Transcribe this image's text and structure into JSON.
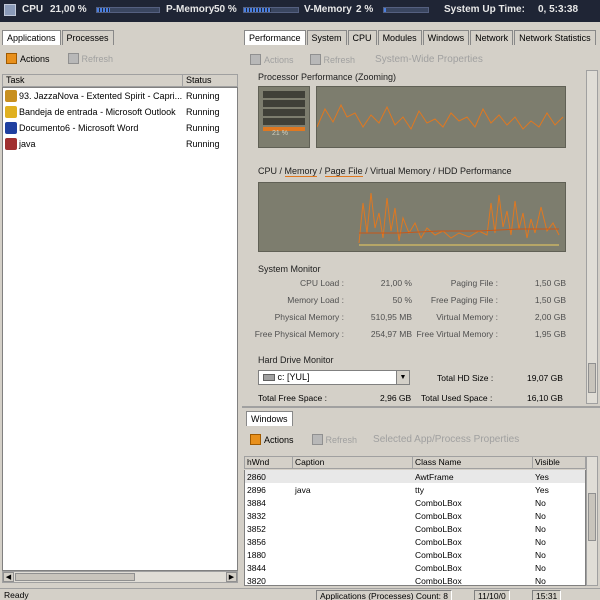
{
  "topbar": {
    "cpu_label": "CPU",
    "cpu_value": "21,00 %",
    "pmem_label": "P-Memory",
    "pmem_value": "50 %",
    "vmem_label": "V-Memory",
    "vmem_value": "2 %",
    "uptime_label": "System Up Time:",
    "uptime_value": "0,  5:3:38",
    "cpu_level": 0.21,
    "pmem_level": 0.5,
    "vmem_level": 0.02
  },
  "left": {
    "tabs": [
      "Applications",
      "Processes"
    ],
    "actions_label": "Actions",
    "refresh_label": "Refresh",
    "columns": [
      "Task",
      "Status"
    ],
    "tasks": [
      {
        "name": "93. JazzaNova - Extented Spirit - Capri...",
        "status": "Running",
        "color": "#c89020"
      },
      {
        "name": "Bandeja de entrada - Microsoft Outlook",
        "status": "Running",
        "color": "#e0b020"
      },
      {
        "name": "Documento6 - Microsoft Word",
        "status": "Running",
        "color": "#2040a0"
      },
      {
        "name": "java",
        "status": "Running",
        "color": "#a03030"
      }
    ]
  },
  "right": {
    "tabs": [
      "Performance",
      "System",
      "CPU",
      "Modules",
      "Windows",
      "Network",
      "Network Statistics"
    ],
    "actions_label": "Actions",
    "refresh_label": "Refresh",
    "props_label": "System-Wide Properties",
    "proc_perf_title": "Processor Performance (Zooming)",
    "proc_perf_value": "21 %",
    "mem_perf_title_parts": [
      "CPU",
      "Memory",
      "Page File",
      "Virtual Memory",
      "HDD Performance"
    ],
    "sysmon_title": "System Monitor",
    "sysmon": [
      {
        "label": "CPU Load :",
        "value": "21,00 %",
        "label2": "Paging File :",
        "value2": "1,50 GB"
      },
      {
        "label": "Memory Load :",
        "value": "50 %",
        "label2": "Free Paging File :",
        "value2": "1,50 GB"
      },
      {
        "label": "Physical Memory :",
        "value": "510,95 MB",
        "label2": "Virtual Memory :",
        "value2": "2,00 GB"
      },
      {
        "label": "Free Physical Memory :",
        "value": "254,97 MB",
        "label2": "Free Virtual Memory :",
        "value2": "1,95 GB"
      }
    ],
    "hdd_title": "Hard Drive Monitor",
    "drive_select": "c: [YUL]",
    "total_hd_label": "Total HD Size :",
    "total_hd_value": "19,07 GB",
    "free_space_label": "Total Free Space :",
    "free_space_value": "2,96 GB",
    "used_space_label": "Total Used Space :",
    "used_space_value": "16,10 GB",
    "windows_tab": "Windows",
    "win_actions": "Actions",
    "win_refresh": "Refresh",
    "win_props": "Selected App/Process Properties",
    "win_columns": [
      "hWnd",
      "Caption",
      "Class Name",
      "Visible"
    ],
    "win_rows": [
      {
        "hwnd": "2860",
        "caption": "",
        "cls": "AwtFrame",
        "vis": "Yes"
      },
      {
        "hwnd": "2896",
        "caption": "java",
        "cls": "tty",
        "vis": "Yes"
      },
      {
        "hwnd": "3884",
        "caption": "",
        "cls": "ComboLBox",
        "vis": "No"
      },
      {
        "hwnd": "3832",
        "caption": "",
        "cls": "ComboLBox",
        "vis": "No"
      },
      {
        "hwnd": "3852",
        "caption": "",
        "cls": "ComboLBox",
        "vis": "No"
      },
      {
        "hwnd": "3856",
        "caption": "",
        "cls": "ComboLBox",
        "vis": "No"
      },
      {
        "hwnd": "1880",
        "caption": "",
        "cls": "ComboLBox",
        "vis": "No"
      },
      {
        "hwnd": "3844",
        "caption": "",
        "cls": "ComboLBox",
        "vis": "No"
      },
      {
        "hwnd": "3820",
        "caption": "",
        "cls": "ComboLBox",
        "vis": "No"
      }
    ]
  },
  "statusbar": {
    "ready": "Ready",
    "count_label": "Applications (Processes) Count: 8",
    "date": "11/10/0",
    "time": "15:31"
  }
}
